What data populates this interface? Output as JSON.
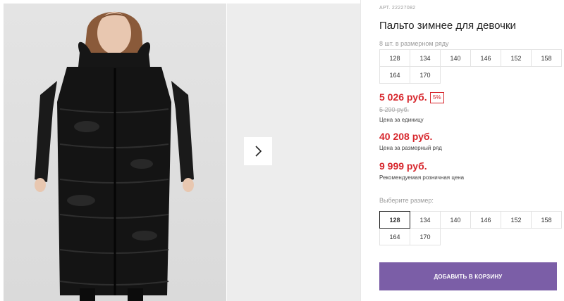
{
  "product": {
    "sku": "АРТ. 22227082",
    "title": "Пальто зимнее для девочки",
    "size_count": "8 шт. в размерном ряду",
    "size_range": [
      "128",
      "134",
      "140",
      "146",
      "152",
      "158",
      "164",
      "170"
    ]
  },
  "pricing": {
    "unit_price": "5 026 руб.",
    "discount": "5%",
    "old_price": "5 290 руб.",
    "unit_label": "Цена за единицу",
    "set_price": "40 208 руб.",
    "set_label": "Цена за размерный ряд",
    "retail_price": "9 999 руб.",
    "retail_label": "Рекомендуемая розничная цена"
  },
  "size_picker": {
    "label": "Выберите размер:",
    "options": [
      "128",
      "134",
      "140",
      "146",
      "152",
      "158",
      "164",
      "170"
    ],
    "selected": "128"
  },
  "cart": {
    "add_label": "ДОБАВИТЬ В КОРЗИНУ"
  },
  "icons": {
    "next": "chevron-right-icon"
  },
  "colors": {
    "price_red": "#d7262c",
    "button_purple": "#7b5ea7"
  }
}
